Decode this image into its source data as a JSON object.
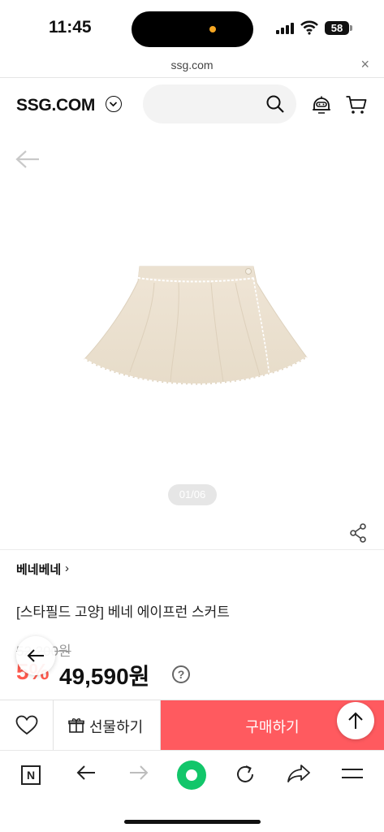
{
  "status_bar": {
    "time": "11:45",
    "battery": "58"
  },
  "browser": {
    "url": "ssg.com",
    "close_glyph": "×"
  },
  "header": {
    "logo": "SSG.COM",
    "icons": [
      "chevron-down-icon",
      "search-icon",
      "chatbot-icon",
      "cart-icon"
    ]
  },
  "gallery": {
    "page_indicator": "01/06"
  },
  "product": {
    "brand": "베네베네",
    "brand_chevron": "›",
    "title": "[스타필드 고양] 베네 에이프런 스커트",
    "original_price": "52,200원",
    "discount": "5%",
    "price": "49,590원",
    "help": "?"
  },
  "buy_bar": {
    "gift_label": "선물하기",
    "buy_label": "구매하기"
  },
  "colors": {
    "accent_red": "#ff5a5f",
    "discount_red": "#ff5a4e",
    "naver_green": "#12c66a"
  },
  "toolbar": {
    "n_label": "N"
  }
}
